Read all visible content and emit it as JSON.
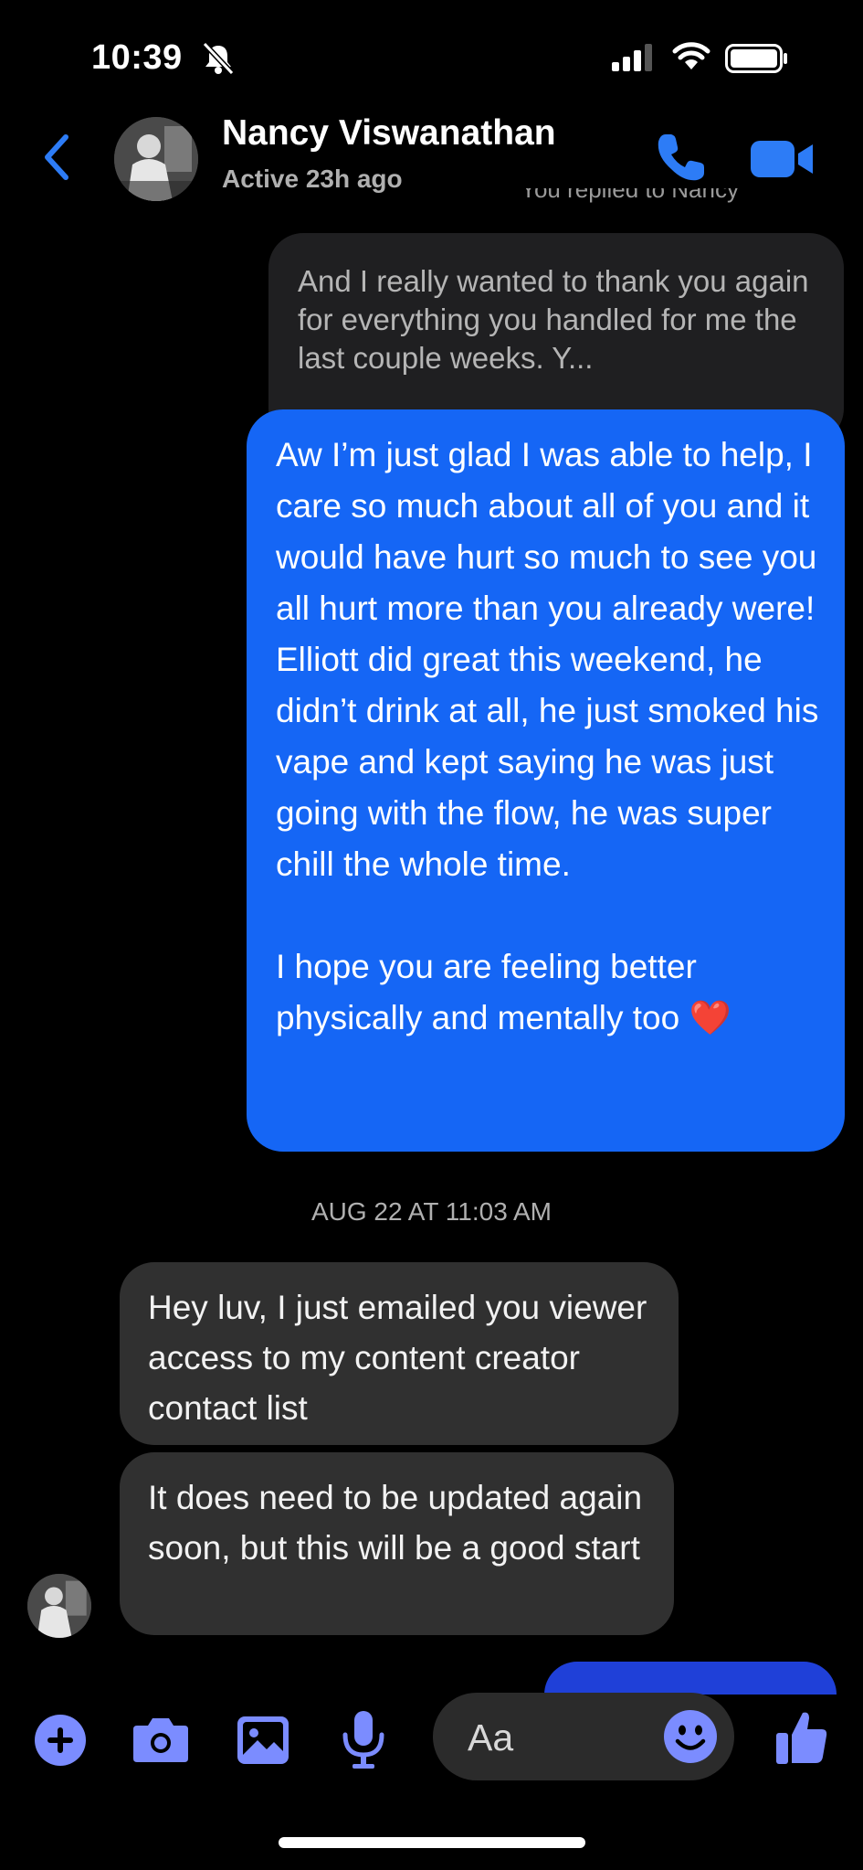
{
  "status_bar": {
    "time": "10:39"
  },
  "header": {
    "contact_name": "Nancy Viswanathan",
    "status": "Active 23h ago"
  },
  "thread": {
    "reply_label": "You replied to Nancy",
    "quoted_text": "And I really wanted to thank you again for everything you handled for me the last couple weeks. Y...",
    "sent_message_p1": "Aw I’m just glad I was able to help, I care so much about all of you and it would have hurt so much to see you all hurt more than you already were! Elliott did great this weekend, he didn’t drink at all, he just smoked his vape and kept saying he was just going with the flow, he was super chill the whole time.",
    "sent_message_p2": "I hope you are feeling better physically and mentally too ❤️",
    "timestamp": "AUG 22 AT 11:03 AM",
    "received": [
      {
        "text": "Hey luv, I just emailed you viewer access to my content creator contact list"
      },
      {
        "text": "It does need to be updated again soon, but this will be a good start"
      }
    ]
  },
  "composer": {
    "placeholder": "Aa"
  },
  "colors": {
    "accent": "#1566F5",
    "icon": "#7B8CFF",
    "header_icon": "#2D7CF6"
  }
}
